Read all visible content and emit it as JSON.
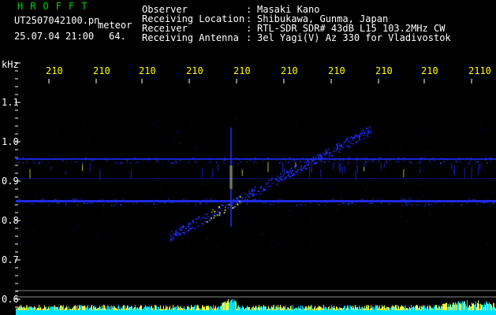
{
  "header": {
    "title": "HROFFT",
    "filename": "UT2507042100.pn",
    "mode": "meteor",
    "datetime": "25.07.04 21:00",
    "count": "64.",
    "info": [
      {
        "label": "Observer",
        "value": "Masaki Kano"
      },
      {
        "label": "Receiving Location",
        "value": "Shibukawa, Gunma, Japan"
      },
      {
        "label": "Receiver",
        "value": "RTL-SDR SDR# 43dB L15 103.2MHz CW"
      },
      {
        "label": "Receiving Antenna",
        "value": "3el Yagi(V) Az 330 for Vladivostok"
      }
    ]
  },
  "axis": {
    "unit": "kHz",
    "y_ticks": [
      "1.1",
      "1.0",
      "0.9",
      "0.8",
      "0.7",
      "0.6"
    ],
    "time_ticks": [
      "210",
      "210",
      "210",
      "210",
      "210",
      "210",
      "210",
      "210",
      "210",
      "2110"
    ]
  },
  "colors": {
    "background": "#000000",
    "text": "#ffffff",
    "time_labels": "#ffff00",
    "title": "#00d000",
    "signal": "#2030ff",
    "hot_signal": "#ffff40",
    "noise_floor": "#00e0ff"
  }
}
